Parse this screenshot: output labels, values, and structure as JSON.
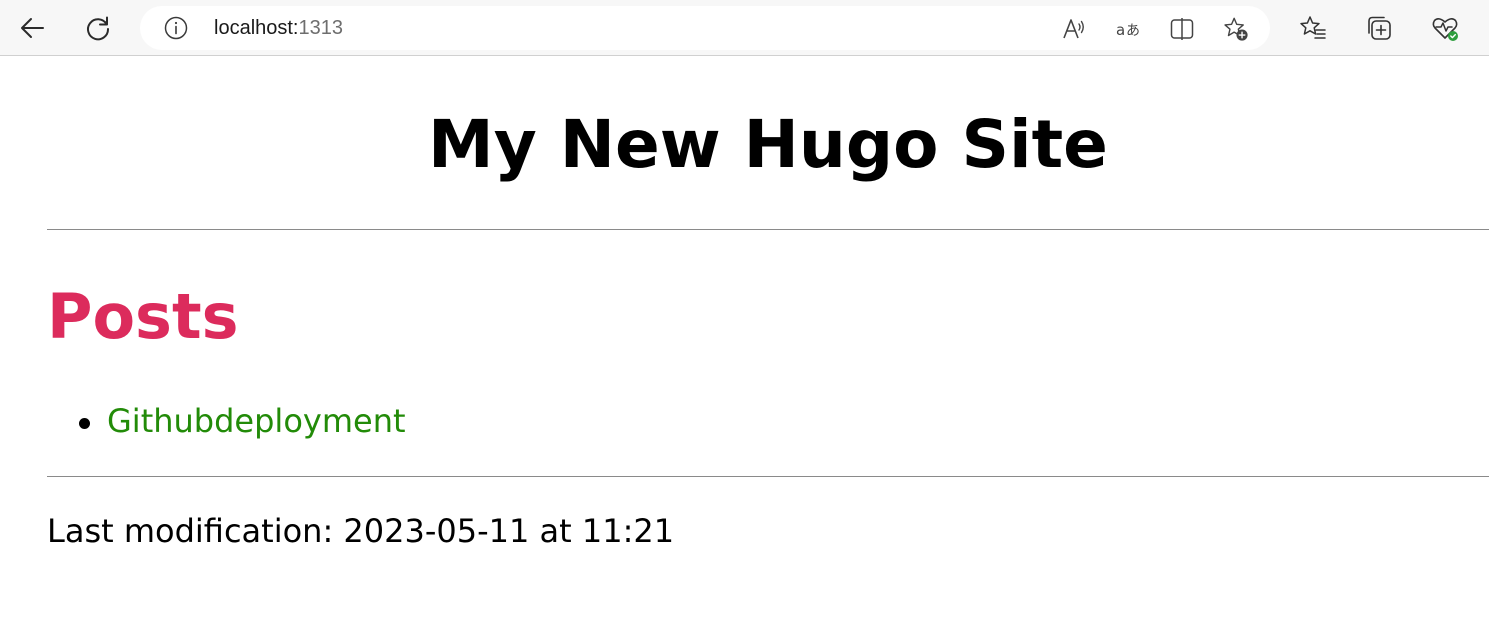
{
  "browser": {
    "address": {
      "host": "localhost:",
      "port": "1313"
    },
    "icons": {
      "back": "back-arrow-icon",
      "refresh": "refresh-icon",
      "info": "site-info-icon",
      "read_aloud": "read-aloud-icon",
      "translate": "translate-icon",
      "split_screen": "split-screen-icon",
      "add_favorite": "add-favorite-icon",
      "favorites": "favorites-icon",
      "collections": "collections-icon",
      "browser_essentials": "browser-essentials-icon"
    }
  },
  "page": {
    "site_title": "My New Hugo Site",
    "section_title": "Posts",
    "posts": [
      {
        "title": "Githubdeployment"
      }
    ],
    "footer": "Last modification: 2023-05-11 at 11:21"
  },
  "colors": {
    "section_title": "#dc2b5c",
    "link": "#228b08",
    "toolbar_bg": "#f7f7f7"
  }
}
